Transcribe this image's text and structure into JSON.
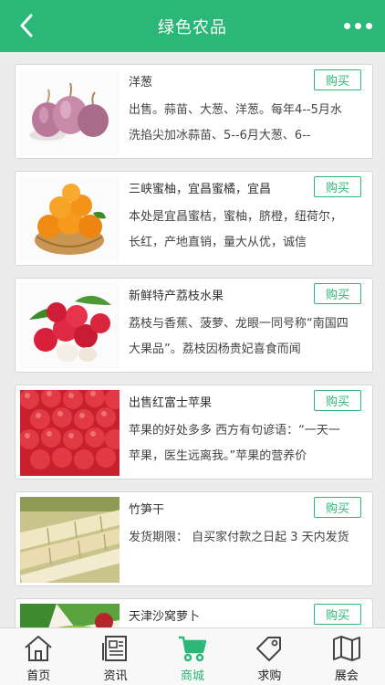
{
  "header": {
    "title": "绿色农品"
  },
  "products": [
    {
      "name": "洋葱",
      "desc": "出售。蒜苗、大葱、洋葱。每年4--5月水洗掐尖加冰蒜苗、5--6月大葱、6--",
      "buy_label": "购买",
      "image": "onion"
    },
    {
      "name": "三峡蜜柚，宜昌蜜橘，宜昌",
      "desc": "本处是宜昌蜜桔，蜜柚，脐橙，纽荷尔，长红，产地直销，量大从优，诚信",
      "buy_label": "购买",
      "image": "orange"
    },
    {
      "name": "新鲜特产荔枝水果",
      "desc": "荔枝与香蕉、菠萝、龙眼一同号称“南国四大果品”。荔枝因杨贵妃喜食而闻",
      "buy_label": "购买",
      "image": "lychee"
    },
    {
      "name": "出售红富士苹果",
      "desc": "苹果的好处多多 西方有句谚语：“一天一苹果，医生远离我。”苹果的营养价",
      "buy_label": "购买",
      "image": "apple"
    },
    {
      "name": "竹笋干",
      "desc": "发货期限： 自买家付款之日起 3 天内发货",
      "buy_label": "购买",
      "image": "bamboo"
    },
    {
      "name": "天津沙窝萝卜",
      "desc": "",
      "buy_label": "购买",
      "image": "radish"
    }
  ],
  "tabbar": {
    "items": [
      {
        "label": "首页",
        "icon": "home-icon"
      },
      {
        "label": "资讯",
        "icon": "news-icon"
      },
      {
        "label": "商城",
        "icon": "cart-icon",
        "active": true
      },
      {
        "label": "求购",
        "icon": "tag-icon"
      },
      {
        "label": "展会",
        "icon": "map-icon"
      }
    ]
  },
  "colors": {
    "accent": "#2ab778",
    "background": "#ececec"
  }
}
